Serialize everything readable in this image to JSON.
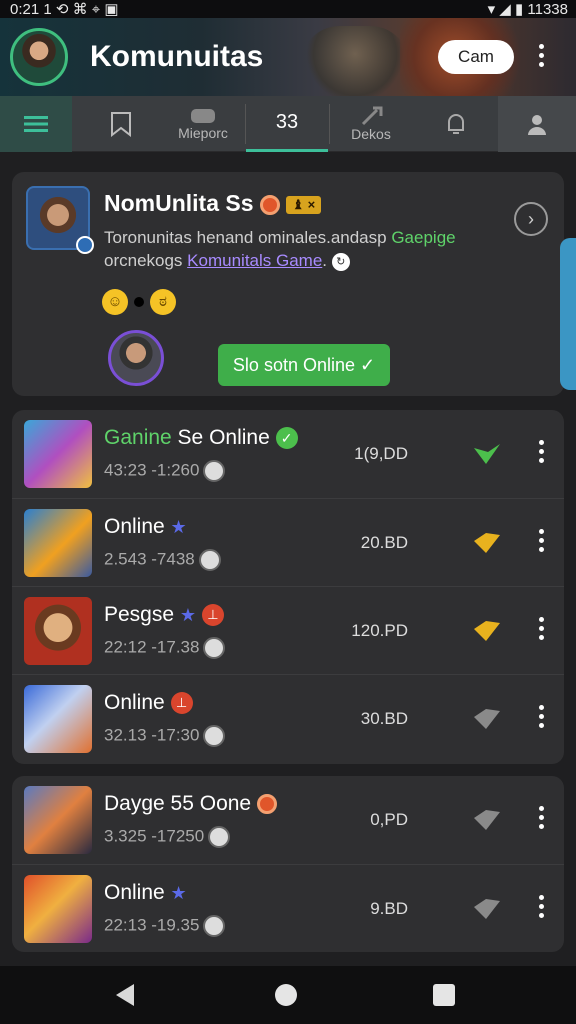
{
  "status_bar": {
    "time": "0:21",
    "left_icons": "1 ⟲ ⌘ ⌖ ▣",
    "right_icons": "▾ ◢ ▮",
    "clock_right": "11338"
  },
  "header": {
    "title": "Komunuitas",
    "cam_button": "Cam"
  },
  "tabs": [
    {
      "label": "",
      "icon": "menu-icon"
    },
    {
      "label": "",
      "icon": "bookmark-icon"
    },
    {
      "label": "Mieporc",
      "icon": "gamepad-icon"
    },
    {
      "label": "33",
      "icon": ""
    },
    {
      "label": "Dekos",
      "icon": "tools-icon"
    },
    {
      "label": "",
      "icon": "bell-icon"
    },
    {
      "label": "",
      "icon": "user-icon"
    }
  ],
  "community": {
    "title": "NomUnlita Ss",
    "badge": "♝ ×",
    "desc_line1_prefix": "Toronunitas henand ominales.andasp ",
    "desc_line1_green": "Gaepige",
    "desc_line2_prefix": "orcnekogs ",
    "desc_line2_link": "Komunitals Game",
    "desc_line2_suffix": ".",
    "emoji1": "☺",
    "emoji2": "ಠ",
    "online_button": "Slo sotn Online ✓"
  },
  "games_group1": [
    {
      "title_green": "Ganine",
      "title": " Se Online",
      "sub": "43:23 -1:260",
      "amount": "1(9,DD",
      "status_color": "#4cbf4c",
      "badge": "check"
    },
    {
      "title_green": "",
      "title": "Online",
      "sub": "2.543 -7438",
      "amount": "20.BD",
      "status_color": "#e8b21e",
      "badge": "star"
    },
    {
      "title_green": "",
      "title": "Pesgse",
      "sub": "22:12 -17.38",
      "amount": "120.PD",
      "status_color": "#e8b21e",
      "badge": "star-red"
    },
    {
      "title_green": "",
      "title": "Online",
      "sub": "32.13 -17:30",
      "amount": "30.BD",
      "status_color": "#8a8a8a",
      "badge": "red"
    }
  ],
  "games_group2": [
    {
      "title_green": "",
      "title": "Dayge 55 Oone",
      "sub": "3.325 -17250",
      "amount": "0,PD",
      "status_color": "#8a8a8a",
      "badge": "orange"
    },
    {
      "title_green": "",
      "title": "Online",
      "sub": "22:13 -19.35",
      "amount": "9.BD",
      "status_color": "#8a8a8a",
      "badge": "star"
    }
  ]
}
